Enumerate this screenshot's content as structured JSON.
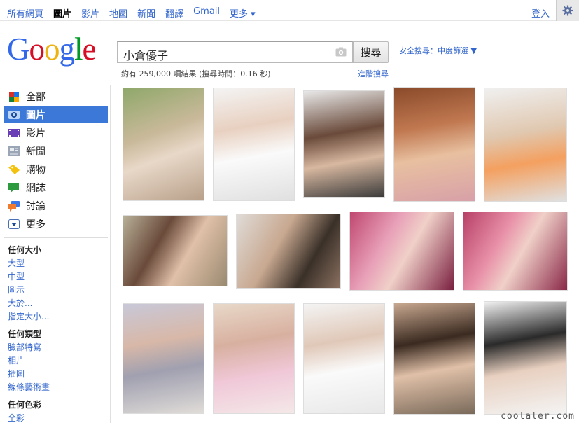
{
  "topbar": {
    "nav": [
      "所有網頁",
      "圖片",
      "影片",
      "地圖",
      "新聞",
      "翻譯",
      "Gmail",
      "更多 ▾"
    ],
    "login": "登入"
  },
  "logo_text": "Google",
  "search": {
    "value": "小倉優子",
    "button": "搜尋"
  },
  "safe_search": "安全搜尋：中度篩選 ▼",
  "stats": "約有 259,000 項結果 (搜尋時間：0.16 秒)",
  "advanced": "進階搜尋",
  "sidebar": {
    "items": [
      {
        "label": "全部",
        "icon": "all-icon"
      },
      {
        "label": "圖片",
        "icon": "images-icon"
      },
      {
        "label": "影片",
        "icon": "videos-icon"
      },
      {
        "label": "新聞",
        "icon": "news-icon"
      },
      {
        "label": "購物",
        "icon": "shopping-icon"
      },
      {
        "label": "網誌",
        "icon": "blogs-icon"
      },
      {
        "label": "討論",
        "icon": "discussions-icon"
      },
      {
        "label": "更多",
        "icon": "more-icon"
      }
    ],
    "size_head": "任何大小",
    "size_links": [
      "大型",
      "中型",
      "圖示",
      "大於...",
      "指定大小..."
    ],
    "type_head": "任何類型",
    "type_links": [
      "臉部特寫",
      "相片",
      "插圖",
      "線條藝術畫"
    ],
    "color_head": "任何色彩",
    "color_links": [
      "全彩"
    ]
  },
  "colors": {
    "link": "#3366cc",
    "active_tab": "#3c78d8",
    "logo": [
      "#3369e8",
      "#d50f25",
      "#eeb211",
      "#3369e8",
      "#009925",
      "#d50f25"
    ]
  },
  "watermark": "coolaler.com"
}
